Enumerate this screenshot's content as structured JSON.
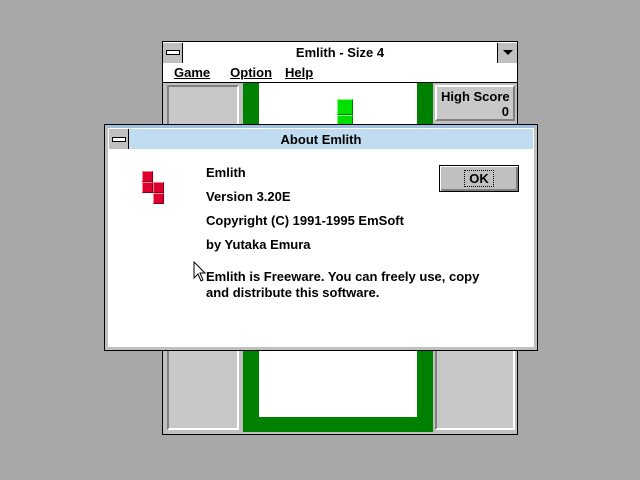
{
  "game_window": {
    "title": "Emlith - Size 4",
    "menu": [
      {
        "label": "Game",
        "accel": "G"
      },
      {
        "label": "Option",
        "accel": "O"
      },
      {
        "label": "Help",
        "accel": "H"
      }
    ],
    "high_score": {
      "label": "High Score",
      "value": "0"
    }
  },
  "about_dialog": {
    "title": "About Emlith",
    "app_name": "Emlith",
    "version": "Version 3.20E",
    "copyright": "Copyright (C) 1991-1995 EmSoft",
    "author": "by Yutaka Emura",
    "freeware_line1": "Emlith is Freeware.  You can freely use, copy",
    "freeware_line2": "and distribute this software.",
    "ok_label": "OK"
  },
  "colors": {
    "desktop": "#a8a8a8",
    "well_green": "#008000",
    "piece_green": "#00e000",
    "icon_red": "#e00030",
    "dialog_title": "#c0dcf0"
  }
}
